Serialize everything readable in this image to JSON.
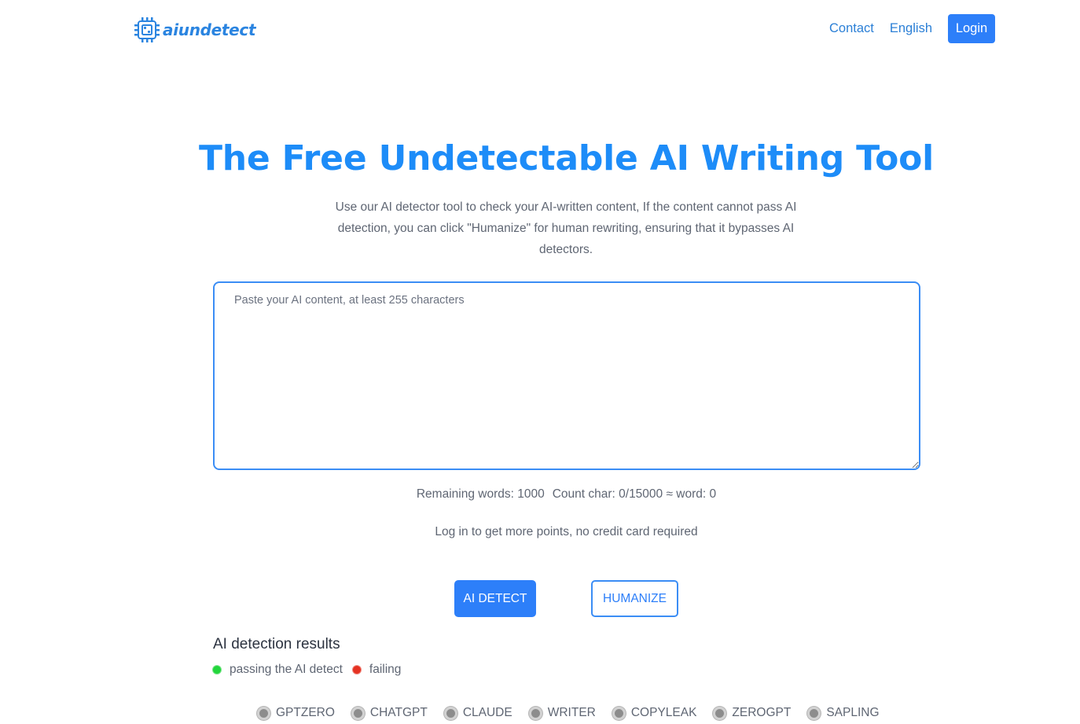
{
  "brand": {
    "name": "aiundetect",
    "accent_color": "#1d8cf8",
    "logo_icon": "chip-icon"
  },
  "nav": {
    "contact": "Contact",
    "language": "English",
    "login": "Login"
  },
  "hero": {
    "title": "The Free Undetectable AI Writing Tool",
    "subtitle": "Use our AI detector tool to check your AI-written content, If the content cannot pass AI detection, you can click \"Humanize\" for human rewriting, ensuring that it bypasses AI detectors."
  },
  "editor": {
    "placeholder": "Paste your AI content, at least 255 characters",
    "value": ""
  },
  "stats": {
    "remaining_words": "Remaining words: 1000",
    "count_char": "Count char: 0/15000 ≈ word: 0"
  },
  "login_hint": "Log in to get more points, no credit card required",
  "actions": {
    "detect": "AI DETECT",
    "humanize": "HUMANIZE"
  },
  "results": {
    "title": "AI detection results",
    "legend": {
      "pass": "passing the AI detect",
      "fail": "failing",
      "pass_color": "#22d63c",
      "fail_color": "#e53222"
    },
    "detectors": [
      "GPTZERO",
      "CHATGPT",
      "CLAUDE",
      "WRITER",
      "COPYLEAK",
      "ZEROGPT",
      "SAPLING"
    ]
  }
}
